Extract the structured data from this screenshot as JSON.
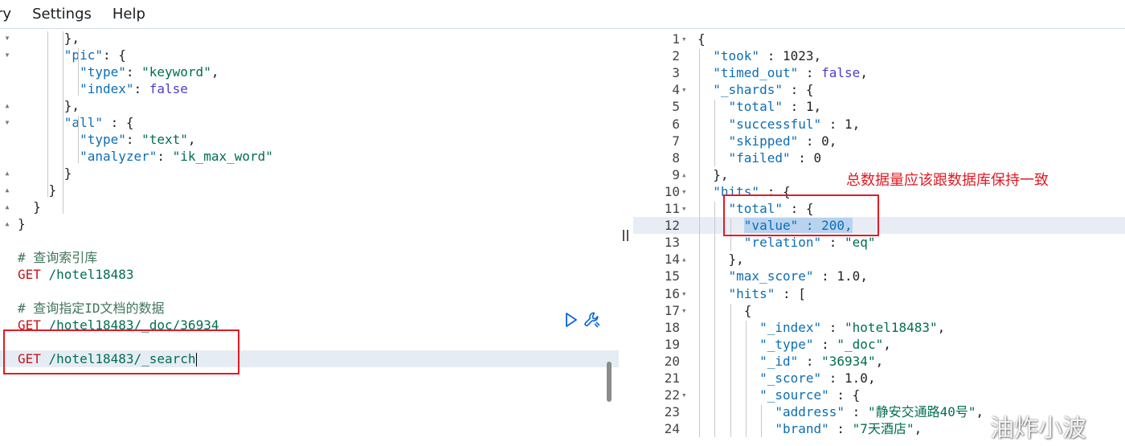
{
  "menu": {
    "items": [
      "ry",
      "Settings",
      "Help"
    ]
  },
  "left_editor": {
    "lines": [
      {
        "gutter": "▾",
        "tokens": [
          [
            "punc",
            "      },"
          ]
        ]
      },
      {
        "gutter": "▾",
        "tokens": [
          [
            "punc",
            "      "
          ],
          [
            "key",
            "\"pic\""
          ],
          [
            "punc",
            ": {"
          ]
        ]
      },
      {
        "gutter": "",
        "tokens": [
          [
            "punc",
            "        "
          ],
          [
            "key",
            "\"type\""
          ],
          [
            "punc",
            ": "
          ],
          [
            "str",
            "\"keyword\""
          ],
          [
            "punc",
            ","
          ]
        ]
      },
      {
        "gutter": "",
        "tokens": [
          [
            "punc",
            "        "
          ],
          [
            "key",
            "\"index\""
          ],
          [
            "punc",
            ": "
          ],
          [
            "bool",
            "false"
          ]
        ]
      },
      {
        "gutter": "▴",
        "tokens": [
          [
            "punc",
            "      },"
          ]
        ]
      },
      {
        "gutter": "▾",
        "tokens": [
          [
            "punc",
            "      "
          ],
          [
            "key",
            "\"all\""
          ],
          [
            "punc",
            " : {"
          ]
        ]
      },
      {
        "gutter": "",
        "tokens": [
          [
            "punc",
            "        "
          ],
          [
            "key",
            "\"type\""
          ],
          [
            "punc",
            ": "
          ],
          [
            "str",
            "\"text\""
          ],
          [
            "punc",
            ","
          ]
        ]
      },
      {
        "gutter": "",
        "tokens": [
          [
            "punc",
            "        "
          ],
          [
            "key",
            "\"analyzer\""
          ],
          [
            "punc",
            ": "
          ],
          [
            "str",
            "\"ik_max_word\""
          ]
        ]
      },
      {
        "gutter": "▴",
        "tokens": [
          [
            "punc",
            "      }"
          ]
        ]
      },
      {
        "gutter": "▴",
        "tokens": [
          [
            "punc",
            "    }"
          ]
        ]
      },
      {
        "gutter": "▴",
        "tokens": [
          [
            "punc",
            "  }"
          ]
        ]
      },
      {
        "gutter": "▴",
        "tokens": [
          [
            "punc",
            "}"
          ]
        ]
      },
      {
        "gutter": "",
        "tokens": []
      },
      {
        "gutter": "",
        "tokens": [
          [
            "comment",
            "# 查询索引库"
          ]
        ]
      },
      {
        "gutter": "",
        "tokens": [
          [
            "method",
            "GET"
          ],
          [
            "path",
            " /hotel18483"
          ]
        ]
      },
      {
        "gutter": "",
        "tokens": []
      },
      {
        "gutter": "",
        "tokens": [
          [
            "comment",
            "# 查询指定ID文档的数据"
          ]
        ]
      },
      {
        "gutter": "",
        "tokens": [
          [
            "method",
            "GET"
          ],
          [
            "path",
            " /hotel18483/_doc/36934"
          ]
        ]
      },
      {
        "gutter": "",
        "tokens": []
      },
      {
        "gutter": "",
        "active": true,
        "caret": true,
        "tokens": [
          [
            "method",
            "GET"
          ],
          [
            "path",
            " /hotel18483/_search"
          ]
        ]
      }
    ]
  },
  "right_editor": {
    "lines": [
      {
        "num": "1",
        "fold": "▾",
        "tokens": [
          [
            "punc",
            "{"
          ]
        ]
      },
      {
        "num": "2",
        "fold": "",
        "tokens": [
          [
            "punc",
            "  "
          ],
          [
            "key",
            "\"took\""
          ],
          [
            "punc",
            " : "
          ],
          [
            "num",
            "1023"
          ],
          [
            "punc",
            ","
          ]
        ]
      },
      {
        "num": "3",
        "fold": "",
        "tokens": [
          [
            "punc",
            "  "
          ],
          [
            "key",
            "\"timed_out\""
          ],
          [
            "punc",
            " : "
          ],
          [
            "bool",
            "false"
          ],
          [
            "punc",
            ","
          ]
        ]
      },
      {
        "num": "4",
        "fold": "▾",
        "tokens": [
          [
            "punc",
            "  "
          ],
          [
            "key",
            "\"_shards\""
          ],
          [
            "punc",
            " : {"
          ]
        ]
      },
      {
        "num": "5",
        "fold": "",
        "tokens": [
          [
            "punc",
            "    "
          ],
          [
            "key",
            "\"total\""
          ],
          [
            "punc",
            " : "
          ],
          [
            "num",
            "1"
          ],
          [
            "punc",
            ","
          ]
        ]
      },
      {
        "num": "6",
        "fold": "",
        "tokens": [
          [
            "punc",
            "    "
          ],
          [
            "key",
            "\"successful\""
          ],
          [
            "punc",
            " : "
          ],
          [
            "num",
            "1"
          ],
          [
            "punc",
            ","
          ]
        ]
      },
      {
        "num": "7",
        "fold": "",
        "tokens": [
          [
            "punc",
            "    "
          ],
          [
            "key",
            "\"skipped\""
          ],
          [
            "punc",
            " : "
          ],
          [
            "num",
            "0"
          ],
          [
            "punc",
            ","
          ]
        ]
      },
      {
        "num": "8",
        "fold": "",
        "tokens": [
          [
            "punc",
            "    "
          ],
          [
            "key",
            "\"failed\""
          ],
          [
            "punc",
            " : "
          ],
          [
            "num",
            "0"
          ]
        ]
      },
      {
        "num": "9",
        "fold": "▴",
        "tokens": [
          [
            "punc",
            "  },"
          ]
        ]
      },
      {
        "num": "10",
        "fold": "▾",
        "tokens": [
          [
            "punc",
            "  "
          ],
          [
            "key",
            "\"hits\""
          ],
          [
            "punc",
            " : {"
          ]
        ]
      },
      {
        "num": "11",
        "fold": "▾",
        "tokens": [
          [
            "punc",
            "    "
          ],
          [
            "key",
            "\"total\""
          ],
          [
            "punc",
            " : {"
          ]
        ]
      },
      {
        "num": "12",
        "fold": "",
        "active": true,
        "tokens": [
          [
            "punc",
            "      "
          ],
          [
            "sel",
            "\"value\" : 200,"
          ]
        ]
      },
      {
        "num": "13",
        "fold": "",
        "tokens": [
          [
            "punc",
            "      "
          ],
          [
            "key",
            "\"relation\""
          ],
          [
            "punc",
            " : "
          ],
          [
            "str",
            "\"eq\""
          ]
        ]
      },
      {
        "num": "14",
        "fold": "▴",
        "tokens": [
          [
            "punc",
            "    },"
          ]
        ]
      },
      {
        "num": "15",
        "fold": "",
        "tokens": [
          [
            "punc",
            "    "
          ],
          [
            "key",
            "\"max_score\""
          ],
          [
            "punc",
            " : "
          ],
          [
            "num",
            "1.0"
          ],
          [
            "punc",
            ","
          ]
        ]
      },
      {
        "num": "16",
        "fold": "▾",
        "tokens": [
          [
            "punc",
            "    "
          ],
          [
            "key",
            "\"hits\""
          ],
          [
            "punc",
            " : ["
          ]
        ]
      },
      {
        "num": "17",
        "fold": "▾",
        "tokens": [
          [
            "punc",
            "      {"
          ]
        ]
      },
      {
        "num": "18",
        "fold": "",
        "tokens": [
          [
            "punc",
            "        "
          ],
          [
            "key",
            "\"_index\""
          ],
          [
            "punc",
            " : "
          ],
          [
            "str",
            "\"hotel18483\""
          ],
          [
            "punc",
            ","
          ]
        ]
      },
      {
        "num": "19",
        "fold": "",
        "tokens": [
          [
            "punc",
            "        "
          ],
          [
            "key",
            "\"_type\""
          ],
          [
            "punc",
            " : "
          ],
          [
            "str",
            "\"_doc\""
          ],
          [
            "punc",
            ","
          ]
        ]
      },
      {
        "num": "20",
        "fold": "",
        "tokens": [
          [
            "punc",
            "        "
          ],
          [
            "key",
            "\"_id\""
          ],
          [
            "punc",
            " : "
          ],
          [
            "str",
            "\"36934\""
          ],
          [
            "punc",
            ","
          ]
        ]
      },
      {
        "num": "21",
        "fold": "",
        "tokens": [
          [
            "punc",
            "        "
          ],
          [
            "key",
            "\"_score\""
          ],
          [
            "punc",
            " : "
          ],
          [
            "num",
            "1.0"
          ],
          [
            "punc",
            ","
          ]
        ]
      },
      {
        "num": "22",
        "fold": "▾",
        "tokens": [
          [
            "punc",
            "        "
          ],
          [
            "key",
            "\"_source\""
          ],
          [
            "punc",
            " : {"
          ]
        ]
      },
      {
        "num": "23",
        "fold": "",
        "tokens": [
          [
            "punc",
            "          "
          ],
          [
            "key",
            "\"address\""
          ],
          [
            "punc",
            " : "
          ],
          [
            "str",
            "\"静安交通路40号\""
          ],
          [
            "punc",
            ","
          ]
        ]
      },
      {
        "num": "24",
        "fold": "",
        "tokens": [
          [
            "punc",
            "          "
          ],
          [
            "key",
            "\"brand\""
          ],
          [
            "punc",
            " : "
          ],
          [
            "str",
            "\"7天酒店\""
          ],
          [
            "punc",
            ","
          ]
        ]
      }
    ]
  },
  "annotation": "总数据量应该跟数据库保持一致",
  "watermark": "油炸小波",
  "icons": {
    "run": "play-icon",
    "settings": "wrench-icon"
  },
  "colors": {
    "highlight_box": "#e01b24",
    "active_line": "#e6ecf4",
    "selection": "#b9d3ef"
  }
}
